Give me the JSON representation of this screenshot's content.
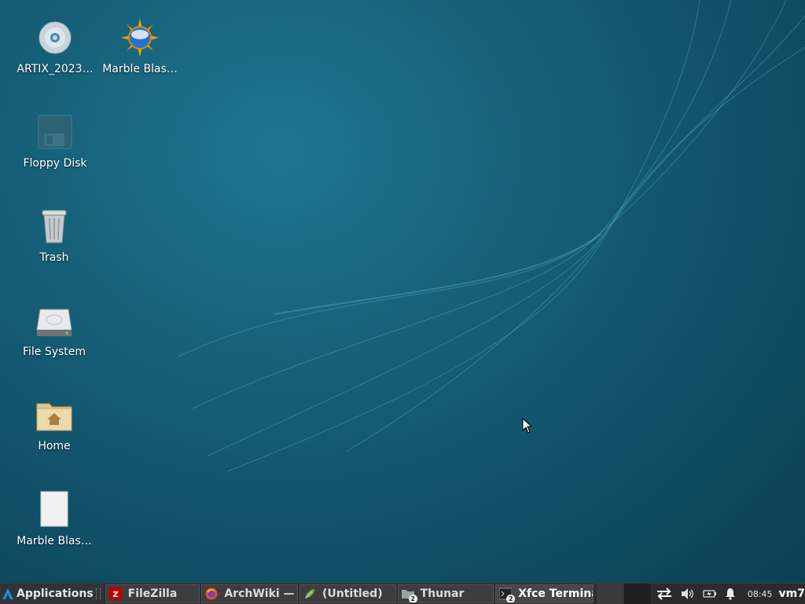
{
  "desktop": {
    "icons": [
      {
        "label": "ARTIX_2023…",
        "icon": "cdrom-icon"
      },
      {
        "label": "Marble Blas…",
        "icon": "marble-blast-icon"
      },
      {
        "label": "Floppy Disk",
        "icon": "floppy-icon"
      },
      {
        "label": "Trash",
        "icon": "trash-icon"
      },
      {
        "label": "File System",
        "icon": "hard-drive-icon"
      },
      {
        "label": "Home",
        "icon": "home-folder-icon"
      },
      {
        "label": "Marble Blas…",
        "icon": "file-icon"
      }
    ]
  },
  "panel": {
    "applications_label": "Applications",
    "tasks": [
      {
        "label": "FileZilla",
        "icon": "filezilla-icon",
        "active": false
      },
      {
        "label": "ArchWiki — …",
        "icon": "firefox-icon",
        "active": false
      },
      {
        "label": "(Untitled)",
        "icon": "mousepad-icon",
        "active": false
      },
      {
        "label": "Thunar",
        "icon": "folder-icon",
        "badge": "2",
        "active": false
      },
      {
        "label": "Xfce Terminal",
        "icon": "terminal-icon",
        "badge": "2",
        "active": true
      }
    ],
    "tray": {
      "network_icon": "network-transfer-icon",
      "volume_icon": "volume-icon",
      "battery_icon": "battery-icon",
      "notification_icon": "bell-icon"
    },
    "clock": "08:45",
    "user": "vm7"
  },
  "colors": {
    "desktop_bg": "#165f78",
    "panel_bg": "#2b2b2b",
    "label_text": "#ffffff"
  }
}
